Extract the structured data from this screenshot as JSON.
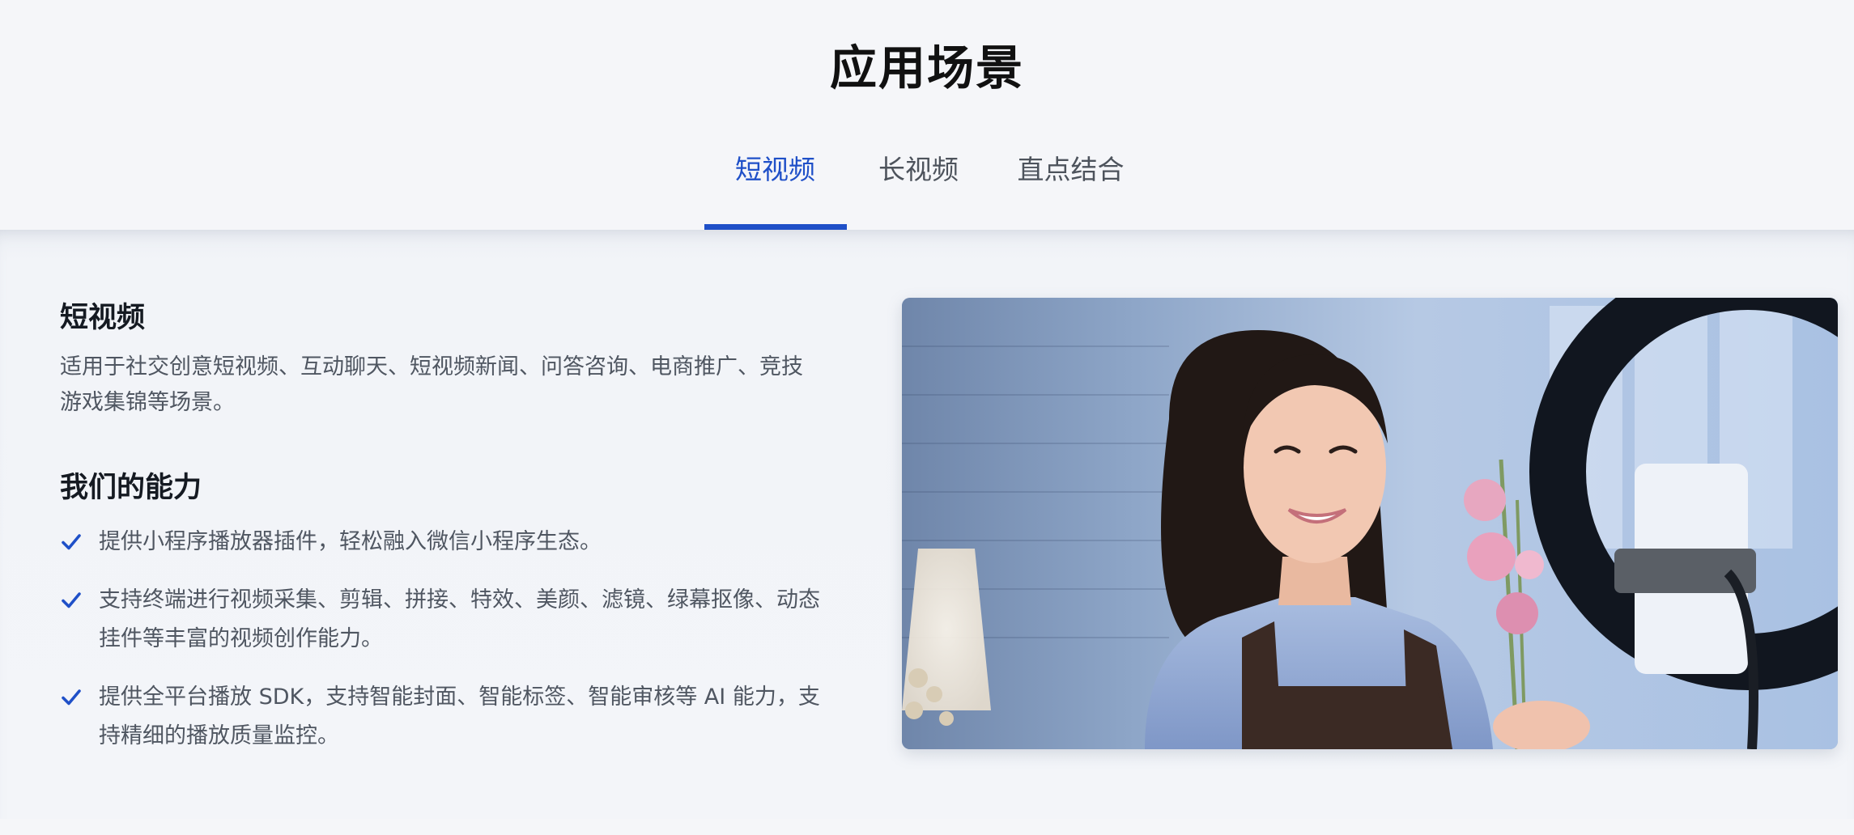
{
  "section": {
    "title": "应用场景"
  },
  "tabs": [
    {
      "label": "短视频",
      "active": true
    },
    {
      "label": "长视频",
      "active": false
    },
    {
      "label": "直点结合",
      "active": false
    }
  ],
  "scene": {
    "heading": "短视频",
    "description": "适用于社交创意短视频、互动聊天、短视频新闻、问答咨询、电商推广、竞技游戏集锦等场景。"
  },
  "abilities": {
    "heading": "我们的能力",
    "items": [
      "提供小程序播放器插件，轻松融入微信小程序生态。",
      "支持终端进行视频采集、剪辑、拼接、特效、美颜、滤镜、绿幕抠像、动态挂件等丰富的视频创作能力。",
      "提供全平台播放 SDK，支持智能封面、智能标签、智能审核等 AI 能力，支持精细的播放质量监控。"
    ]
  },
  "colors": {
    "accent": "#1f50c8",
    "check": "#1f50c8"
  },
  "icons": {
    "check": "check-icon"
  }
}
